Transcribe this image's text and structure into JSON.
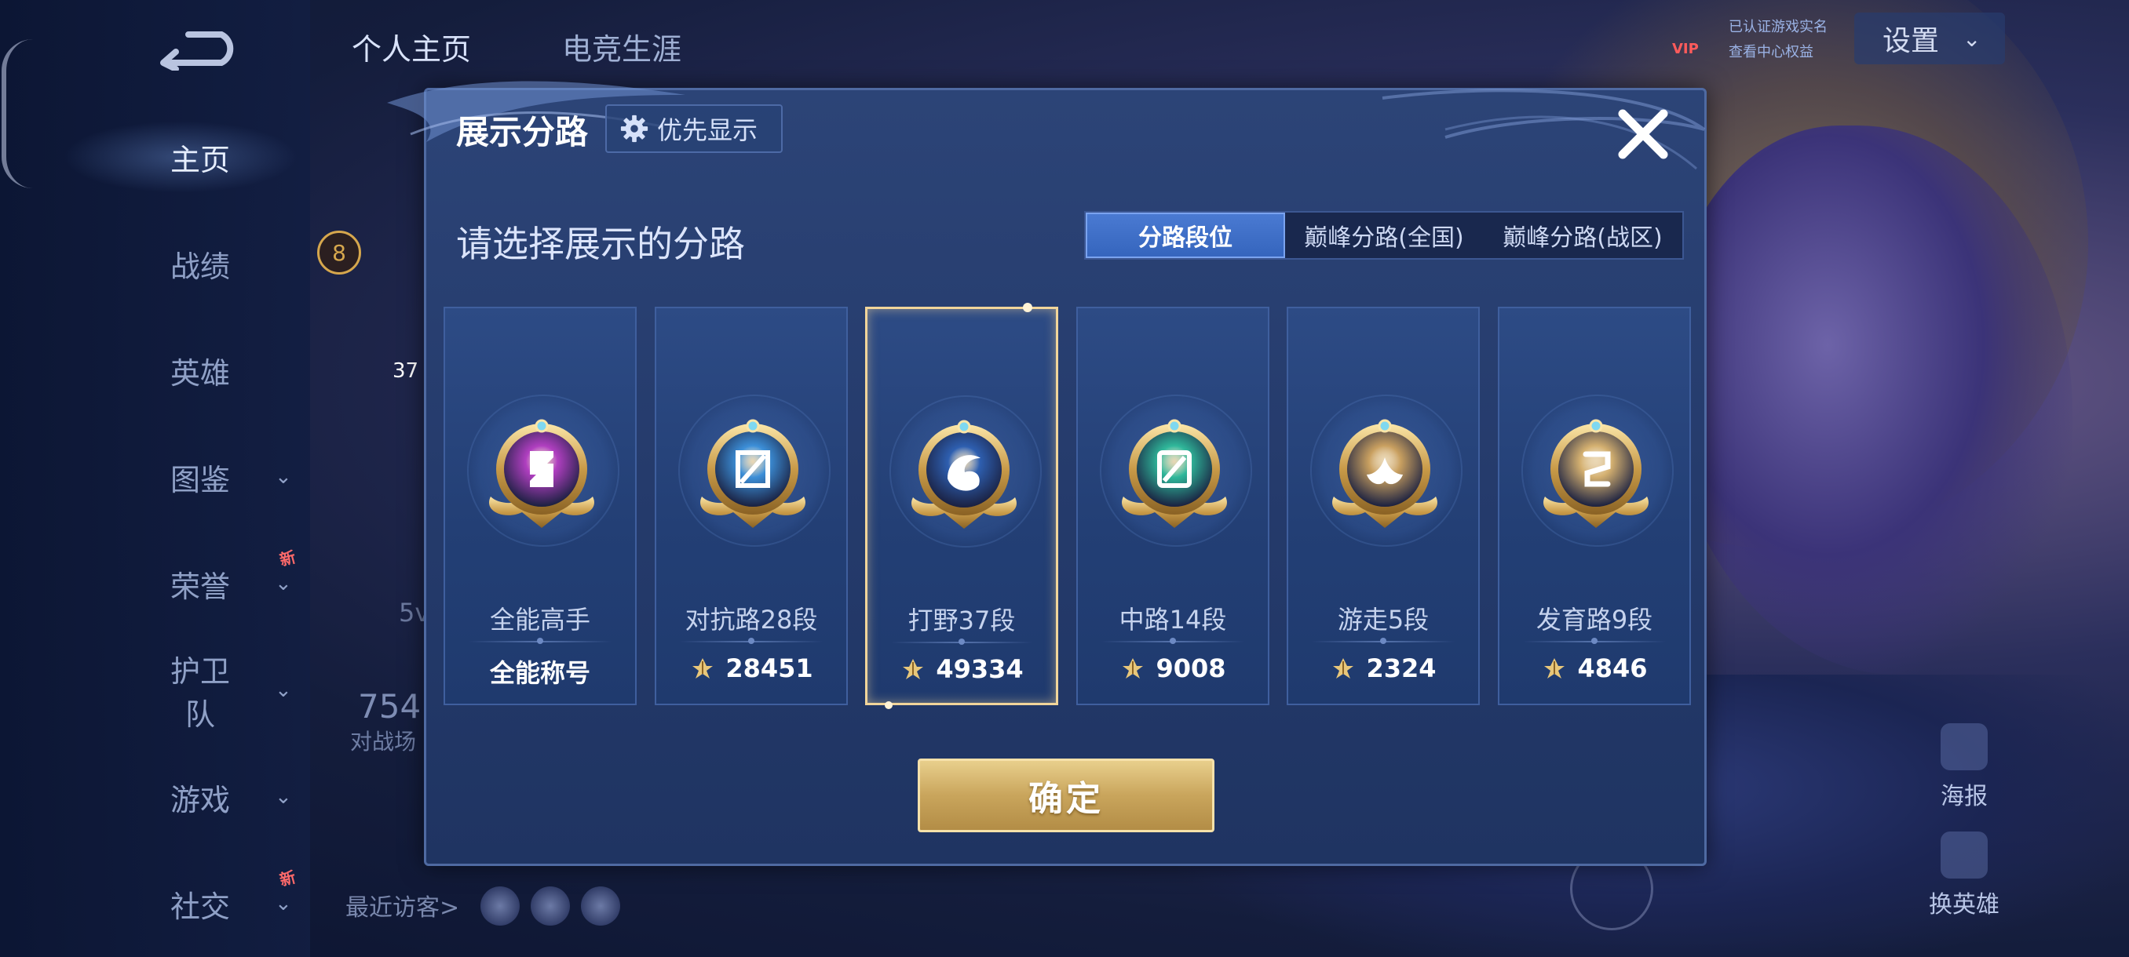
{
  "header": {
    "tabs": [
      "个人主页",
      "电竞生涯"
    ],
    "settings_label": "设置",
    "vip_label": "VIP",
    "vip_line1": "已认证游戏实名",
    "vip_line2": "查看中心权益"
  },
  "sidebar": {
    "items": [
      {
        "label": "主页",
        "active": true,
        "has_chevron": false,
        "is_new": false
      },
      {
        "label": "战绩",
        "active": false,
        "has_chevron": false,
        "is_new": false
      },
      {
        "label": "英雄",
        "active": false,
        "has_chevron": false,
        "is_new": false
      },
      {
        "label": "图鉴",
        "active": false,
        "has_chevron": true,
        "is_new": false
      },
      {
        "label": "荣誉",
        "active": false,
        "has_chevron": true,
        "is_new": true
      },
      {
        "label": "护卫队",
        "active": false,
        "has_chevron": true,
        "is_new": false
      },
      {
        "label": "游戏",
        "active": false,
        "has_chevron": true,
        "is_new": false
      },
      {
        "label": "社交",
        "active": false,
        "has_chevron": true,
        "is_new": true
      }
    ],
    "new_badge": "新"
  },
  "profile_background": {
    "level": "8",
    "num_37": "37",
    "num_5v": "5v",
    "number_754": "754",
    "battle_label": "对战场",
    "recent_visitors": "最近访客>"
  },
  "right_buttons": {
    "poster": "海报",
    "change_hero": "换英雄"
  },
  "modal": {
    "title": "展示分路",
    "priority_button": "优先显示",
    "subtitle": "请选择展示的分路",
    "tabs": [
      {
        "label": "分路段位",
        "active": true
      },
      {
        "label": "巅峰分路(全国)",
        "active": false
      },
      {
        "label": "巅峰分路(战区)",
        "active": false
      }
    ],
    "cards": [
      {
        "name": "全能高手",
        "value": "全能称号",
        "has_points_icon": false,
        "selected": false,
        "medal_color": "#b03fc0",
        "medal_icon": "allround-icon"
      },
      {
        "name": "对抗路28段",
        "value": "28451",
        "has_points_icon": true,
        "selected": false,
        "medal_color": "#3c8fd8",
        "medal_icon": "sword-shield-icon"
      },
      {
        "name": "打野37段",
        "value": "49334",
        "has_points_icon": true,
        "selected": true,
        "medal_color": "#2e5fb0",
        "medal_icon": "dragon-icon"
      },
      {
        "name": "中路14段",
        "value": "9008",
        "has_points_icon": true,
        "selected": false,
        "medal_color": "#2fb79a",
        "medal_icon": "staff-icon"
      },
      {
        "name": "游走5段",
        "value": "2324",
        "has_points_icon": true,
        "selected": false,
        "medal_color": "#c9a060",
        "medal_icon": "wings-icon"
      },
      {
        "name": "发育路9段",
        "value": "4846",
        "has_points_icon": true,
        "selected": false,
        "medal_color": "#d4b070",
        "medal_icon": "bow-icon"
      }
    ],
    "confirm_button": "确定"
  },
  "colors": {
    "accent_gold": "#f1d59a",
    "tab_active": "#3565bd",
    "modal_bg": "#253b6c",
    "new_badge": "#ff6a6a"
  }
}
